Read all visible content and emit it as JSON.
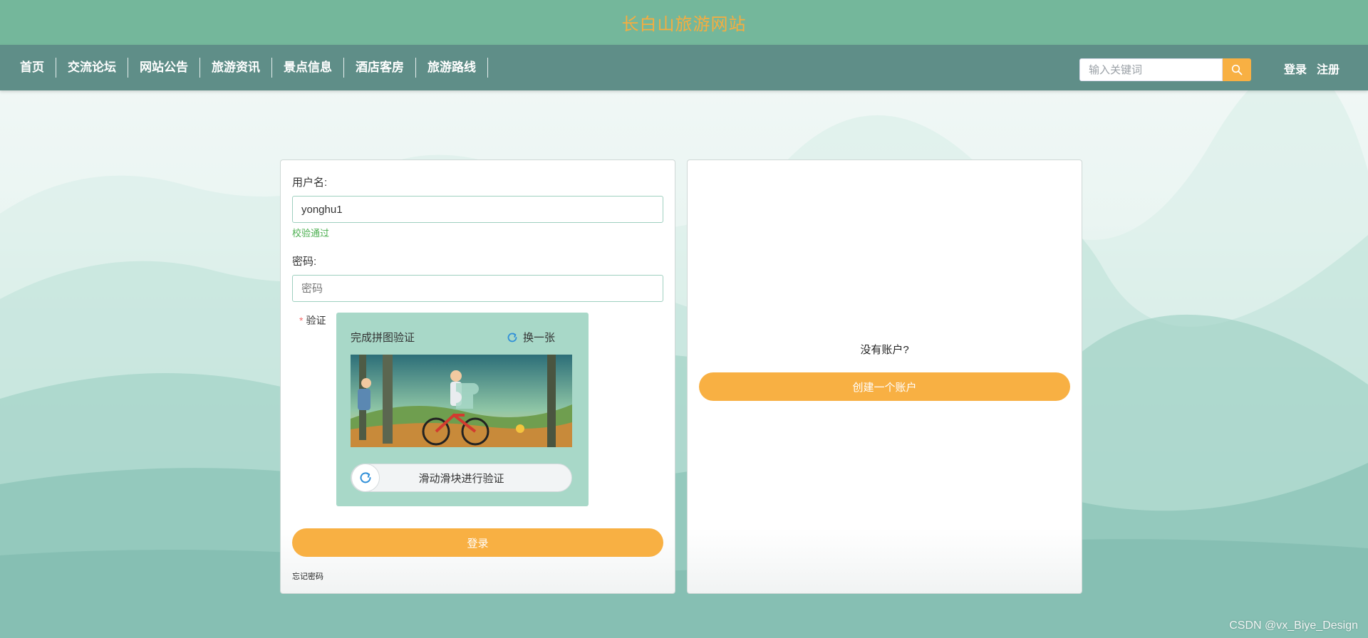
{
  "header": {
    "site_title": "长白山旅游网站"
  },
  "nav": {
    "items": [
      {
        "label": "首页"
      },
      {
        "label": "交流论坛"
      },
      {
        "label": "网站公告"
      },
      {
        "label": "旅游资讯"
      },
      {
        "label": "景点信息"
      },
      {
        "label": "酒店客房"
      },
      {
        "label": "旅游路线"
      }
    ],
    "search": {
      "placeholder": "输入关键词",
      "value": ""
    },
    "login_label": "登录",
    "register_label": "注册"
  },
  "login_form": {
    "username_label": "用户名:",
    "username_value": "yonghu1",
    "username_status": "校验通过",
    "password_label": "密码:",
    "password_placeholder": "密码",
    "verify_required_mark": "*",
    "verify_label": "验证",
    "captcha": {
      "title": "完成拼图验证",
      "refresh_label": "换一张",
      "slider_text": "滑动滑块进行验证"
    },
    "submit_label": "登录",
    "forgot_label": "忘记密码"
  },
  "register_panel": {
    "prompt": "没有账户?",
    "create_label": "创建一个账户"
  },
  "watermark": "CSDN @vx_Biye_Design",
  "colors": {
    "title_bar": "#74b79b",
    "nav_bar": "#5f8e88",
    "accent": "#f8b043",
    "success": "#4caf50",
    "captcha_bg": "#a8d8c8"
  }
}
